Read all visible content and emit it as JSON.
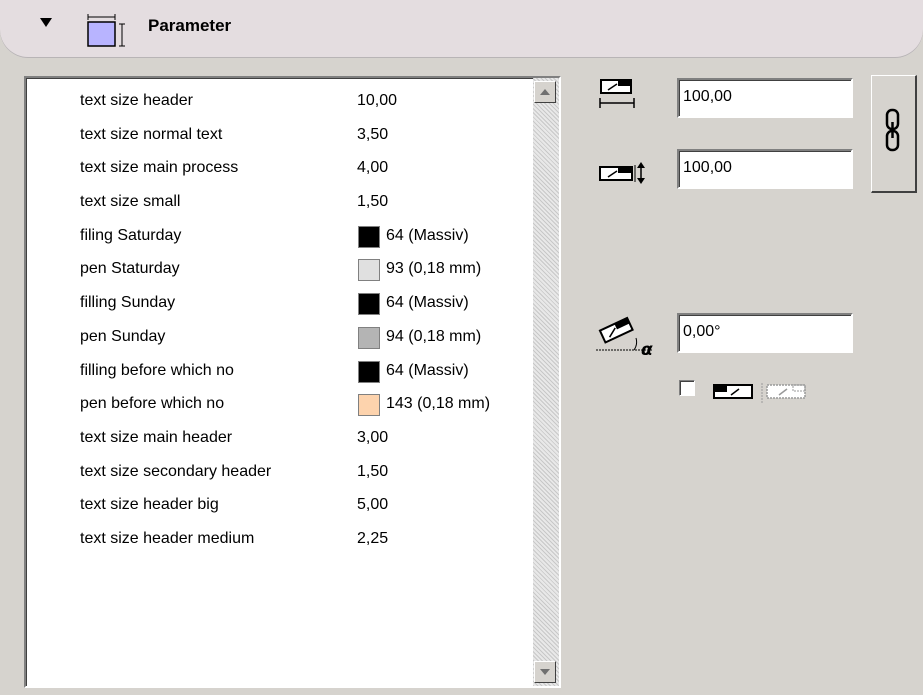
{
  "header": {
    "title": "Parameter",
    "icon": "object-size-icon"
  },
  "params": [
    {
      "name": "text size header",
      "value": "10,00"
    },
    {
      "name": "text size normal text",
      "value": "3,50"
    },
    {
      "name": "text size main process",
      "value": "4,00"
    },
    {
      "name": "text size small",
      "value": "1,50"
    },
    {
      "name": "filing Saturday",
      "value": "64 (Massiv)",
      "swatch": "#000000"
    },
    {
      "name": "pen Staturday",
      "value": "93 (0,18 mm)",
      "swatch": "#e0e0e0"
    },
    {
      "name": "filling Sunday",
      "value": "64 (Massiv)",
      "swatch": "#000000"
    },
    {
      "name": "pen Sunday",
      "value": "94 (0,18 mm)",
      "swatch": "#b4b4b4"
    },
    {
      "name": "filling before which no",
      "value": "64 (Massiv)",
      "swatch": "#000000"
    },
    {
      "name": "pen before which no",
      "value": "143 (0,18 mm)",
      "swatch": "#fdd3ad"
    },
    {
      "name": "text size main header",
      "value": "3,00"
    },
    {
      "name": "text size secondary header",
      "value": "1,50"
    },
    {
      "name": "text size header big",
      "value": "5,00"
    },
    {
      "name": "text size header medium",
      "value": "2,25"
    }
  ],
  "width_field": {
    "value": "100,00",
    "icon": "width-icon"
  },
  "height_field": {
    "value": "100,00",
    "icon": "height-icon"
  },
  "angle_field": {
    "value": "0,00°",
    "icon": "rotation-angle-icon"
  },
  "link_button": {
    "icon": "chain-link-icon"
  },
  "mirror": {
    "checked": false,
    "icons": [
      "mirror-normal-icon",
      "mirror-flipped-icon"
    ]
  }
}
